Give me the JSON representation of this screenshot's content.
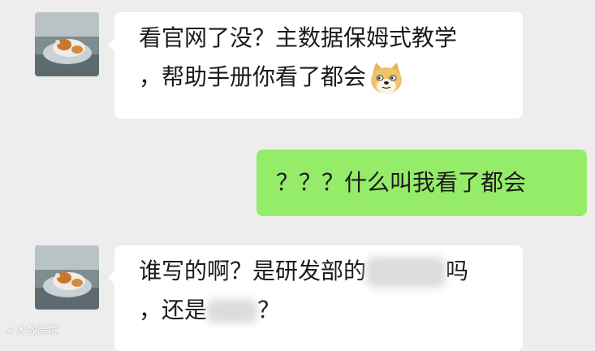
{
  "messages": [
    {
      "from": "other",
      "lines": [
        "看官网了没？主数据保姆式教学",
        "，帮助手册你看了都会"
      ],
      "avatar_icon": "cat-on-blanket-avatar-icon",
      "trailing_emoji": "doge-emoji-icon"
    },
    {
      "from": "me",
      "text": "？？？什么叫我看了都会"
    },
    {
      "from": "other",
      "line1_before": "谁写的啊？是研发部的",
      "line1_after": "吗",
      "line2_before": "，还是",
      "line2_after": "？",
      "avatar_icon": "cat-on-blanket-avatar-icon"
    }
  ],
  "watermark": "大数跨境",
  "colors": {
    "background": "#ededed",
    "incoming_bubble": "#ffffff",
    "outgoing_bubble": "#95ec69"
  }
}
